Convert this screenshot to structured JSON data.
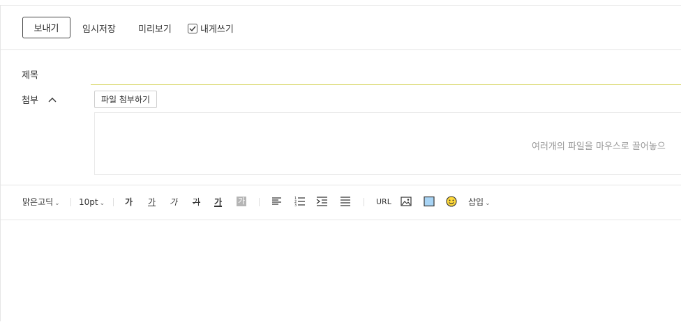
{
  "toolbar_top": {
    "send_label": "보내기",
    "draft_label": "임시저장",
    "preview_label": "미리보기",
    "self_label": "내게쓰기"
  },
  "fields": {
    "subject_label": "제목",
    "subject_value": "",
    "attach_label": "첨부",
    "attach_button": "파일 첨부하기",
    "dropzone_text": "여러개의 파일을 마우스로 끌어놓으"
  },
  "editor_toolbar": {
    "font_family": "맑은고딕",
    "font_size": "10pt",
    "bold": "가",
    "underline": "가",
    "italic": "가",
    "strike": "가",
    "font_color": "가",
    "bg_color": "가",
    "url_label": "URL",
    "insert_label": "삽입"
  },
  "colors": {
    "accent_underline": "#d9d86a",
    "table_icon_fill": "#a8d4f5",
    "emoji_fill": "#ffd93b"
  }
}
